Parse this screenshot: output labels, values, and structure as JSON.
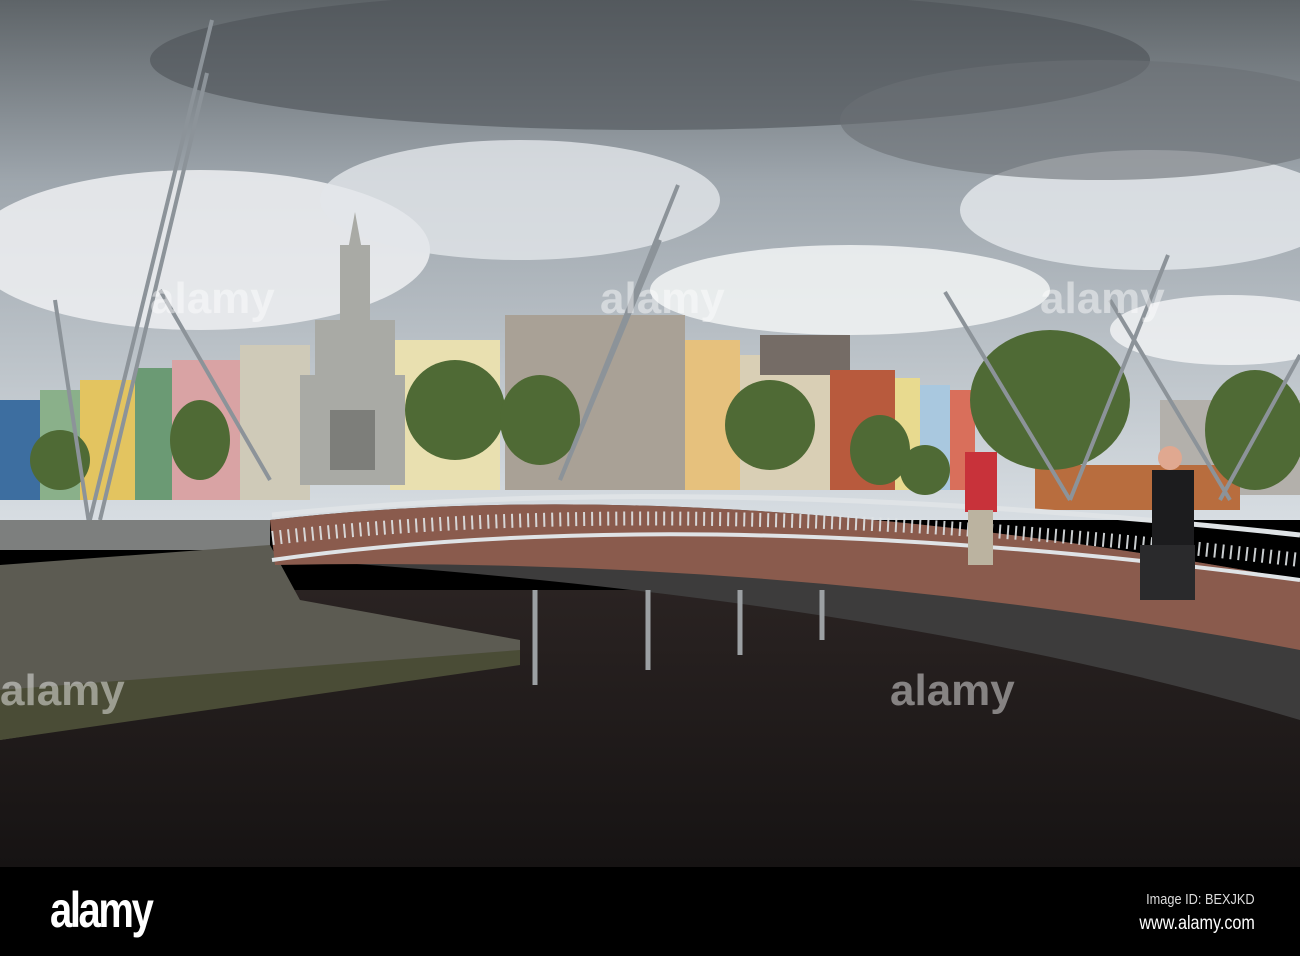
{
  "photo": {
    "subject": "Footbridge over river with city buildings and monument",
    "watermark": "alamy"
  },
  "footer": {
    "logo": "alamy",
    "image_id": "Image ID: BEXJKD",
    "url": "www.alamy.com"
  },
  "colors": {
    "sky": "#c9d3dc",
    "water": "#1e1a1a",
    "bar": "#000000"
  }
}
